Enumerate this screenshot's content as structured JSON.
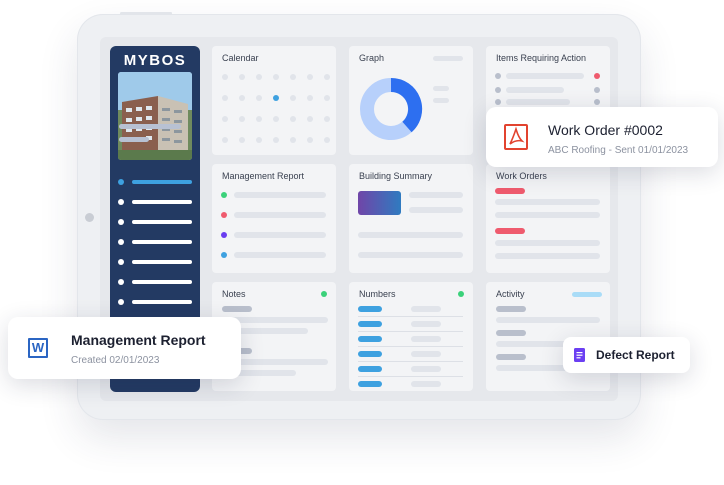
{
  "brand": {
    "logo_text": "MYBOS"
  },
  "cards": {
    "calendar": {
      "title": "Calendar"
    },
    "graph": {
      "title": "Graph"
    },
    "items_action": {
      "title": "Items Requiring Action"
    },
    "management_report": {
      "title": "Management Report"
    },
    "building_summary": {
      "title": "Building Summary"
    },
    "work_orders": {
      "title": "Work Orders"
    },
    "notes": {
      "title": "Notes"
    },
    "numbers": {
      "title": "Numbers"
    },
    "activity": {
      "title": "Activity"
    }
  },
  "popups": {
    "work_order": {
      "title": "Work Order #0002",
      "subtitle": "ABC Roofing - Sent 01/01/2023",
      "icon": "pdf-icon"
    },
    "management_report": {
      "title": "Management Report",
      "subtitle": "Created 02/01/2023",
      "icon": "word-icon",
      "icon_letter": "W"
    },
    "defect_report": {
      "title": "Defect Report",
      "icon": "document-icon"
    }
  },
  "colors": {
    "sidebar": "#233a63",
    "accent_blue": "#3ea1e0",
    "green": "#3bd17a",
    "red": "#ef5b6e",
    "purple": "#6a3df0",
    "pdf_red": "#e2432f",
    "word_blue": "#2b65c3",
    "defect_purple": "#6b3ff2"
  }
}
